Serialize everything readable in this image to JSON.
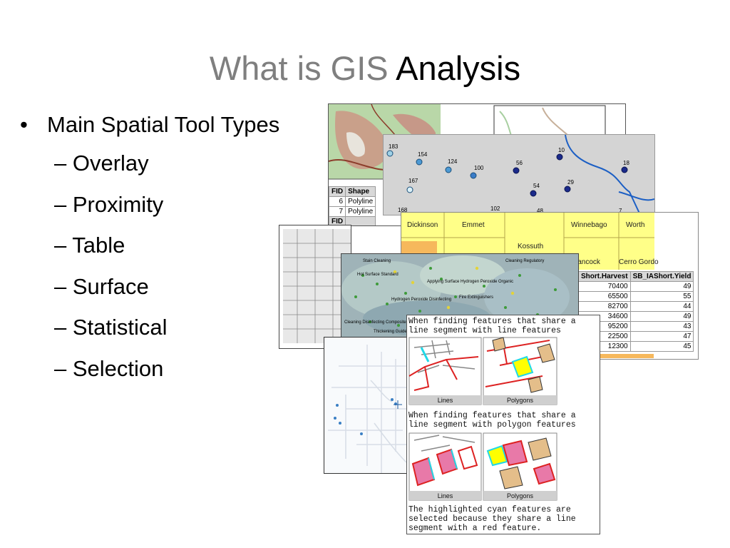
{
  "slide": {
    "title_part1": "What is GIS",
    "title_part2": "Analysis",
    "bullet_marker": "•",
    "bullet": "Main Spatial Tool Types",
    "sub_items": [
      "– Overlay",
      "– Proximity",
      "– Table",
      "– Surface",
      "– Statistical",
      "– Selection"
    ]
  },
  "attribute_table": {
    "headers": [
      "FID",
      "Shape"
    ],
    "rows": [
      [
        "6",
        "Polyline"
      ],
      [
        "7",
        "Polyline"
      ]
    ],
    "sub_header": "FID"
  },
  "point_map": {
    "labels": [
      "183",
      "154",
      "124",
      "100",
      "56",
      "10",
      "18",
      "167",
      "54",
      "29",
      "168",
      "102",
      "48",
      "7"
    ]
  },
  "county_map": {
    "counties": [
      "Dickinson",
      "Emmet",
      "Kossuth",
      "Winnebago",
      "Worth",
      "Hancock",
      "Cerro Gordo"
    ]
  },
  "yield_table": {
    "headers": [
      "Short.Harvest",
      "SB_IAShort.Yield"
    ],
    "rows": [
      [
        "70400",
        "49"
      ],
      [
        "65500",
        "55"
      ],
      [
        "82700",
        "44"
      ],
      [
        "34600",
        "49"
      ],
      [
        "95200",
        "43"
      ],
      [
        "22500",
        "47"
      ],
      [
        "12300",
        "45"
      ]
    ]
  },
  "surface_map": {
    "labels": [
      "Stain Cleaning",
      "Hot Surface Standard",
      "Applying Surface Hydrogen Peroxide Organic",
      "Cleaning Regulatory",
      "Hydrogen Peroxide Disinfecting",
      "Fire Extinguishers",
      "Cleaning Disinfecting Composite",
      "Thickening Guide"
    ]
  },
  "selection_help": {
    "caption1": "When finding features that share a line segment with line features",
    "caption2": "When finding features that share a line segment with polygon features",
    "caption3": "The highlighted cyan features are selected because they share a line segment with a red feature.",
    "lines_label": "Lines",
    "polygons_label": "Polygons"
  }
}
